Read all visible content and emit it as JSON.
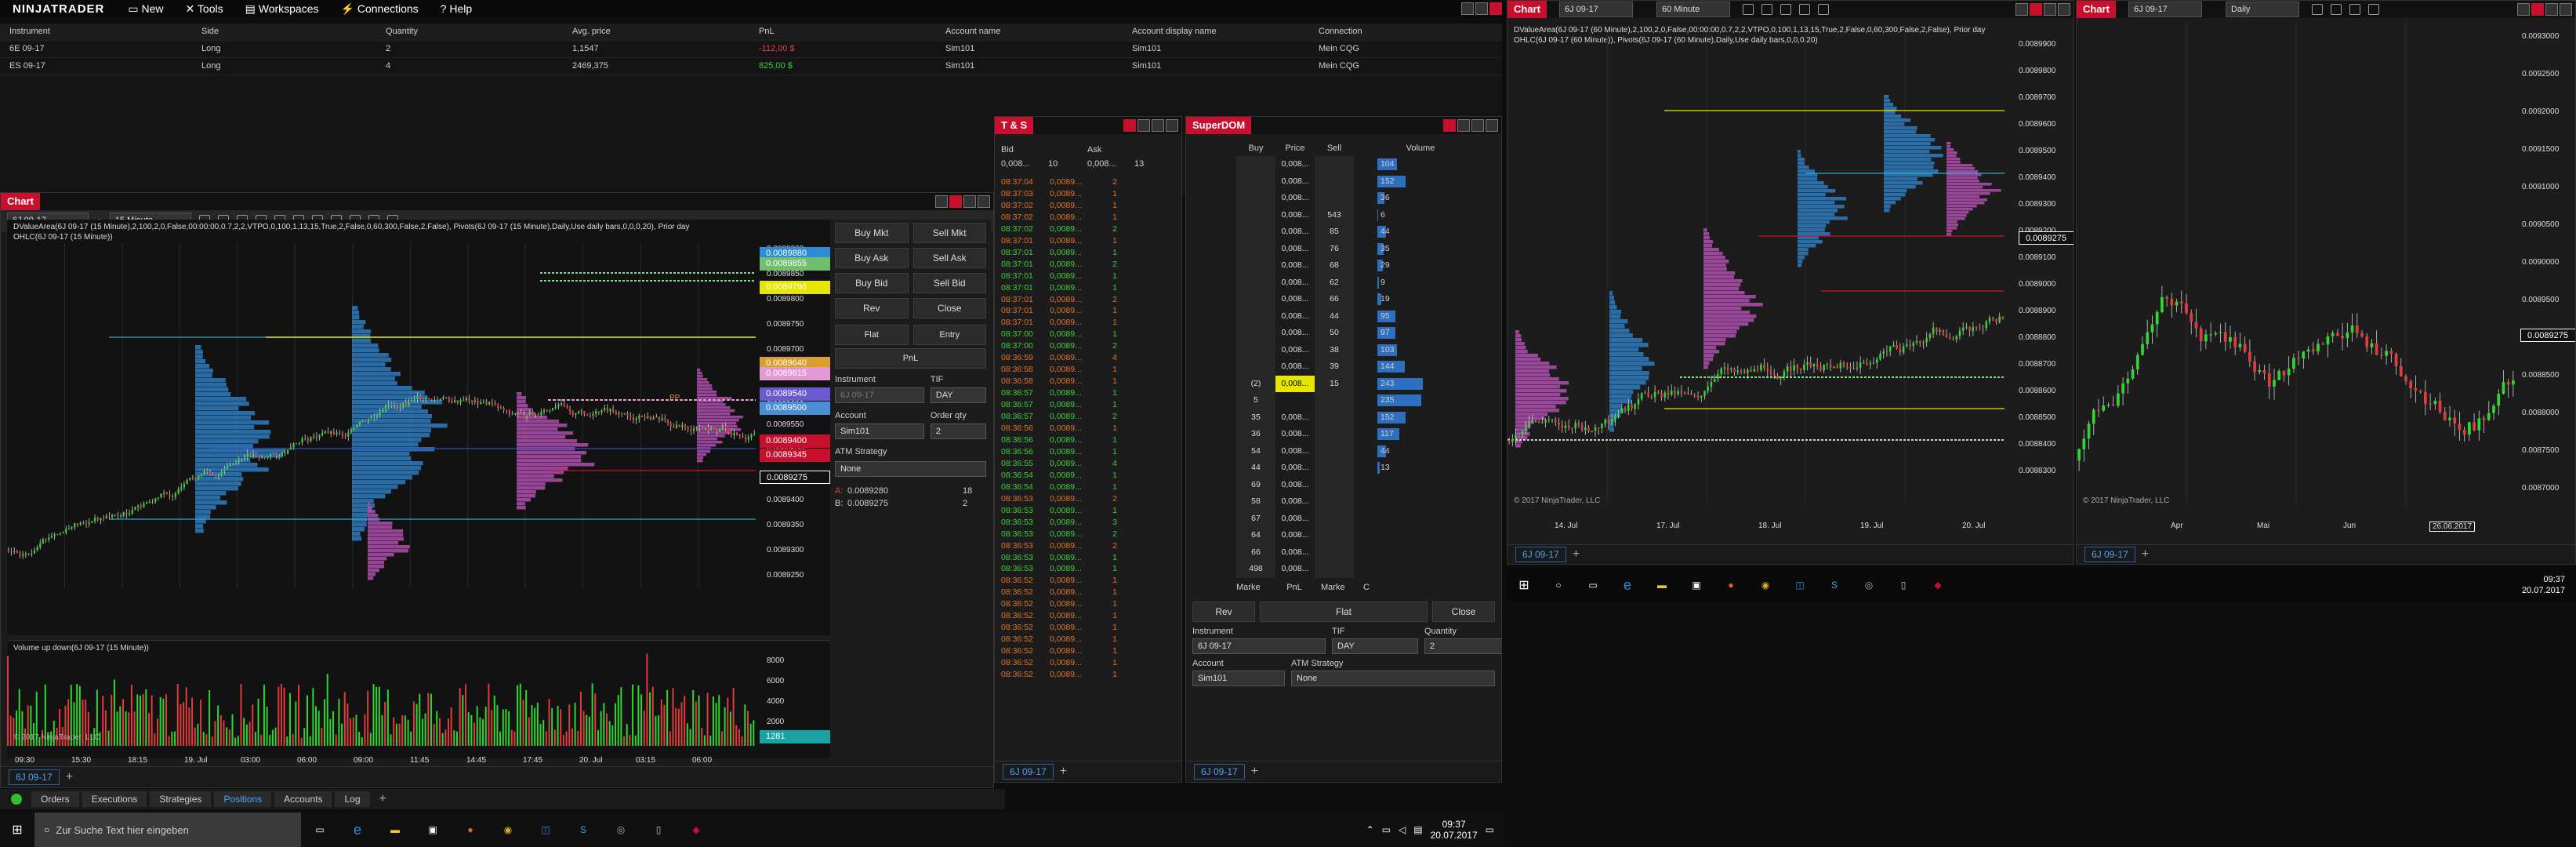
{
  "app": {
    "logo": "NINJATRADER",
    "menu": [
      "New",
      "Tools",
      "Workspaces",
      "Connections",
      "Help"
    ]
  },
  "positions": {
    "headers": [
      "Instrument",
      "Side",
      "Quantity",
      "Avg. price",
      "PnL",
      "Account name",
      "Account display name",
      "Connection"
    ],
    "rows": [
      {
        "instrument": "6E 09-17",
        "side": "Long",
        "qty": "2",
        "avg": "1,1547",
        "pnl": "-112,00 $",
        "account": "Sim101",
        "display": "Sim101",
        "connection": "Mein CQG"
      },
      {
        "instrument": "ES 09-17",
        "side": "Long",
        "qty": "4",
        "avg": "2469,375",
        "pnl": "825,00 $",
        "account": "Sim101",
        "display": "Sim101",
        "connection": "Mein CQG"
      }
    ],
    "tabs": [
      "Orders",
      "Executions",
      "Strategies",
      "Positions",
      "Accounts",
      "Log"
    ],
    "active_tab": "Positions"
  },
  "chart1": {
    "title": "Chart",
    "instrument": "6J 09-17",
    "interval": "15 Minute",
    "legend1": "DValueArea(6J 09-17 (15 Minute),2,100,2,0,False,00:00:00,0.7,2,2,VTPO,0,100,1,13,15,True,2,False,0,60,300,False,2,False), Pivots(6J 09-17 (15 Minute),Daily,Use daily bars,0,0,0,20), Prior day",
    "legend2": "OHLC(6J 09-17 (15 Minute))",
    "copyright": "© 2017 NinjaTrader, LLC",
    "volume_label": "Volume up down(6J 09-17 (15 Minute))",
    "pp_label": "PP",
    "price_ticks": [
      "0.0089900",
      "0.0089850",
      "0.0089800",
      "0.0089750",
      "0.0089700",
      "0.0089650",
      "0.0089600",
      "0.0089550",
      "0.0089500",
      "0.0089450",
      "0.0089400",
      "0.0089350",
      "0.0089300",
      "0.0089250"
    ],
    "price_labels": [
      {
        "text": "0.0089880",
        "color": "#2e8bd6"
      },
      {
        "text": "0.0089855",
        "color": "#6fbf6f"
      },
      {
        "text": "0.0089790",
        "color": "#e6e600"
      },
      {
        "text": "0.0089640",
        "color": "#d99e2b"
      },
      {
        "text": "0.0089615",
        "color": "#e39ad1"
      },
      {
        "text": "0.0089540",
        "color": "#6a5acd"
      },
      {
        "text": "0.0089500",
        "color": "#4a8fd6"
      },
      {
        "text": "0.0089400",
        "color": "#c8102e"
      },
      {
        "text": "0.0089345",
        "color": "#c8102e"
      },
      {
        "text": "0.0089275",
        "color": "#111111"
      }
    ],
    "vol_ticks": [
      "8000",
      "6000",
      "4000",
      "2000"
    ],
    "vol_last": "1281",
    "time_ticks": [
      "09:30",
      "15:30",
      "18:15",
      "19. Jul",
      "03:00",
      "06:00",
      "09:00",
      "11:45",
      "14:45",
      "17:45",
      "20. Jul",
      "03:15",
      "06:00"
    ],
    "tab": "6J 09-17",
    "chart_trader": {
      "buttons": [
        "Buy Mkt",
        "Sell Mkt",
        "Buy Ask",
        "Sell Ask",
        "Buy Bid",
        "Sell Bid",
        "Rev",
        "Close"
      ],
      "flat": "Flat",
      "entry": "Entry",
      "pnl": "PnL",
      "instrument_label": "Instrument",
      "instrument_value": "6J 09-17",
      "tif_label": "TIF",
      "tif_value": "DAY",
      "account_label": "Account",
      "account_value": "Sim101",
      "qty_label": "Order qty",
      "qty_value": "2",
      "atm_label": "ATM Strategy",
      "atm_value": "None",
      "pos_a_label": "A:",
      "pos_a_price": "0.0089280",
      "pos_a_qty": "18",
      "pos_b_label": "B:",
      "pos_b_price": "0.0089275",
      "pos_b_qty": "2"
    }
  },
  "ts": {
    "title": "T & S",
    "bid_label": "Bid",
    "ask_label": "Ask",
    "bid": "0,008...",
    "bid_size": "10",
    "ask": "0,008...",
    "ask_size": "13",
    "rows": [
      [
        "08:37:04",
        "0,0089...",
        "2",
        "o"
      ],
      [
        "08:37:03",
        "0,0089...",
        "1",
        "o"
      ],
      [
        "08:37:02",
        "0,0089...",
        "1",
        "o"
      ],
      [
        "08:37:02",
        "0,0089...",
        "1",
        "o"
      ],
      [
        "08:37:02",
        "0,0089...",
        "2",
        "g"
      ],
      [
        "08:37:01",
        "0,0089...",
        "1",
        "o"
      ],
      [
        "08:37:01",
        "0,0089...",
        "1",
        "g"
      ],
      [
        "08:37:01",
        "0,0089...",
        "2",
        "g"
      ],
      [
        "08:37:01",
        "0,0089...",
        "1",
        "g"
      ],
      [
        "08:37:01",
        "0,0089...",
        "1",
        "g"
      ],
      [
        "08:37:01",
        "0,0089...",
        "2",
        "o"
      ],
      [
        "08:37:01",
        "0,0089...",
        "1",
        "o"
      ],
      [
        "08:37:01",
        "0,0089...",
        "1",
        "o"
      ],
      [
        "08:37:00",
        "0,0089...",
        "1",
        "g"
      ],
      [
        "08:37:00",
        "0,0089...",
        "2",
        "g"
      ],
      [
        "08:36:59",
        "0,0089...",
        "4",
        "o"
      ],
      [
        "08:36:58",
        "0,0089...",
        "1",
        "o"
      ],
      [
        "08:36:58",
        "0,0089...",
        "1",
        "o"
      ],
      [
        "08:36:57",
        "0,0089...",
        "1",
        "g"
      ],
      [
        "08:36:57",
        "0,0089...",
        "1",
        "g"
      ],
      [
        "08:36:57",
        "0,0089...",
        "2",
        "g"
      ],
      [
        "08:36:56",
        "0,0089...",
        "1",
        "o"
      ],
      [
        "08:36:56",
        "0,0089...",
        "1",
        "g"
      ],
      [
        "08:36:56",
        "0,0089...",
        "1",
        "g"
      ],
      [
        "08:36:55",
        "0,0089...",
        "4",
        "g"
      ],
      [
        "08:36:54",
        "0,0089...",
        "1",
        "g"
      ],
      [
        "08:36:54",
        "0,0089...",
        "1",
        "g"
      ],
      [
        "08:36:53",
        "0,0089...",
        "2",
        "o"
      ],
      [
        "08:36:53",
        "0,0089...",
        "1",
        "g"
      ],
      [
        "08:36:53",
        "0,0089...",
        "3",
        "g"
      ],
      [
        "08:36:53",
        "0,0089...",
        "2",
        "g"
      ],
      [
        "08:36:53",
        "0,0089...",
        "2",
        "o"
      ],
      [
        "08:36:53",
        "0,0089...",
        "1",
        "g"
      ],
      [
        "08:36:53",
        "0,0089...",
        "1",
        "g"
      ],
      [
        "08:36:52",
        "0,0089...",
        "1",
        "o"
      ],
      [
        "08:36:52",
        "0,0089...",
        "1",
        "o"
      ],
      [
        "08:36:52",
        "0,0089...",
        "1",
        "o"
      ],
      [
        "08:36:52",
        "0,0089...",
        "1",
        "o"
      ],
      [
        "08:36:52",
        "0,0089...",
        "1",
        "o"
      ],
      [
        "08:36:52",
        "0,0089...",
        "1",
        "o"
      ],
      [
        "08:36:52",
        "0,0089...",
        "1",
        "o"
      ],
      [
        "08:36:52",
        "0,0089...",
        "1",
        "o"
      ],
      [
        "08:36:52",
        "0,0089...",
        "1",
        "o"
      ]
    ],
    "tab": "6J 09-17"
  },
  "superdom": {
    "title": "SuperDOM",
    "headers": [
      "Buy",
      "Price",
      "Sell",
      "Volume"
    ],
    "rows": [
      {
        "buy": "",
        "price": "0,008...",
        "sell": "",
        "vol": "104"
      },
      {
        "buy": "",
        "price": "0,008...",
        "sell": "",
        "vol": "152"
      },
      {
        "buy": "",
        "price": "0,008...",
        "sell": "",
        "vol": "36"
      },
      {
        "buy": "",
        "price": "0,008...",
        "sell": "543",
        "vol": "6"
      },
      {
        "buy": "",
        "price": "0,008...",
        "sell": "85",
        "vol": "44"
      },
      {
        "buy": "",
        "price": "0,008...",
        "sell": "76",
        "vol": "35"
      },
      {
        "buy": "",
        "price": "0,008...",
        "sell": "68",
        "vol": "29"
      },
      {
        "buy": "",
        "price": "0,008...",
        "sell": "62",
        "vol": "9"
      },
      {
        "buy": "",
        "price": "0,008...",
        "sell": "66",
        "vol": "19"
      },
      {
        "buy": "",
        "price": "0,008...",
        "sell": "44",
        "vol": "95"
      },
      {
        "buy": "",
        "price": "0,008...",
        "sell": "50",
        "vol": "97"
      },
      {
        "buy": "",
        "price": "0,008...",
        "sell": "38",
        "vol": "103"
      },
      {
        "buy": "",
        "price": "0,008...",
        "sell": "39",
        "vol": "144"
      },
      {
        "buy": "(2)",
        "price": "0,008...",
        "sell": "15",
        "vol": "243"
      },
      {
        "buy": "5",
        "price": "",
        "sell": "",
        "vol": "235"
      },
      {
        "buy": "35",
        "price": "0,008...",
        "sell": "",
        "vol": "152"
      },
      {
        "buy": "36",
        "price": "0,008...",
        "sell": "",
        "vol": "117"
      },
      {
        "buy": "54",
        "price": "0,008...",
        "sell": "",
        "vol": "44"
      },
      {
        "buy": "44",
        "price": "0,008...",
        "sell": "",
        "vol": "13"
      },
      {
        "buy": "69",
        "price": "0,008...",
        "sell": "",
        "vol": ""
      },
      {
        "buy": "58",
        "price": "0,008...",
        "sell": "",
        "vol": ""
      },
      {
        "buy": "67",
        "price": "0,008...",
        "sell": "",
        "vol": ""
      },
      {
        "buy": "64",
        "price": "0,008...",
        "sell": "",
        "vol": ""
      },
      {
        "buy": "66",
        "price": "0,008...",
        "sell": "",
        "vol": ""
      },
      {
        "buy": "498",
        "price": "0,008...",
        "sell": "",
        "vol": ""
      }
    ],
    "marke_left": "Marke",
    "pnl": "PnL",
    "marke_right": "Marke",
    "c": "C",
    "rev": "Rev",
    "flat": "Flat",
    "close": "Close",
    "instrument_label": "Instrument",
    "instrument_value": "6J 09-17",
    "tif_label": "TIF",
    "tif_value": "DAY",
    "qty_label": "Quantity",
    "qty_value": "2",
    "account_label": "Account",
    "account_value": "Sim101",
    "atm_label": "ATM Strategy",
    "atm_value": "None",
    "tab": "6J 09-17"
  },
  "chart2": {
    "title": "Chart",
    "instrument": "6J 09-17",
    "interval": "60 Minute",
    "legend1": "DValueArea(6J 09-17 (60 Minute),2,100,2,0,False,00:00:00,0.7,2,2,VTPO,0,100,1,13,15,True,2,False,0,60,300,False,2,False), Prior day",
    "legend2": "OHLC(6J 09-17 (60 Minute)), Pivots(6J 09-17 (60 Minute),Daily,Use daily bars,0,0,0,20)",
    "copyright": "© 2017 NinjaTrader, LLC",
    "price_ticks": [
      "0.0089900",
      "0.0089800",
      "0.0089700",
      "0.0089600",
      "0.0089500",
      "0.0089400",
      "0.0089300",
      "0.0089200",
      "0.0089100",
      "0.0089000",
      "0.0088900",
      "0.0088800",
      "0.0088700",
      "0.0088600",
      "0.0088500",
      "0.0088400",
      "0.0088300"
    ],
    "last_price": "0.0089275",
    "time_ticks": [
      "14. Jul",
      "17. Jul",
      "18. Jul",
      "19. Jul",
      "20. Jul"
    ],
    "tab": "6J 09-17"
  },
  "chart3": {
    "title": "Chart",
    "instrument": "6J 09-17",
    "interval": "Daily",
    "copyright": "© 2017 NinjaTrader, LLC",
    "price_ticks": [
      "0.0093000",
      "0.0092500",
      "0.0092000",
      "0.0091500",
      "0.0091000",
      "0.0090500",
      "0.0090000",
      "0.0089500",
      "0.0089000",
      "0.0088500",
      "0.0088000",
      "0.0087500",
      "0.0087000"
    ],
    "last_price": "0.0089275",
    "time_ticks": [
      "Apr",
      "Mai",
      "Jun",
      "26.06.2017"
    ],
    "tab": "6J 09-17"
  },
  "taskbar_left": {
    "search_placeholder": "Zur Suche Text hier eingeben",
    "time": "09:37",
    "date": "20.07.2017"
  },
  "taskbar_right": {
    "time": "09:37",
    "date": "20.07.2017"
  }
}
